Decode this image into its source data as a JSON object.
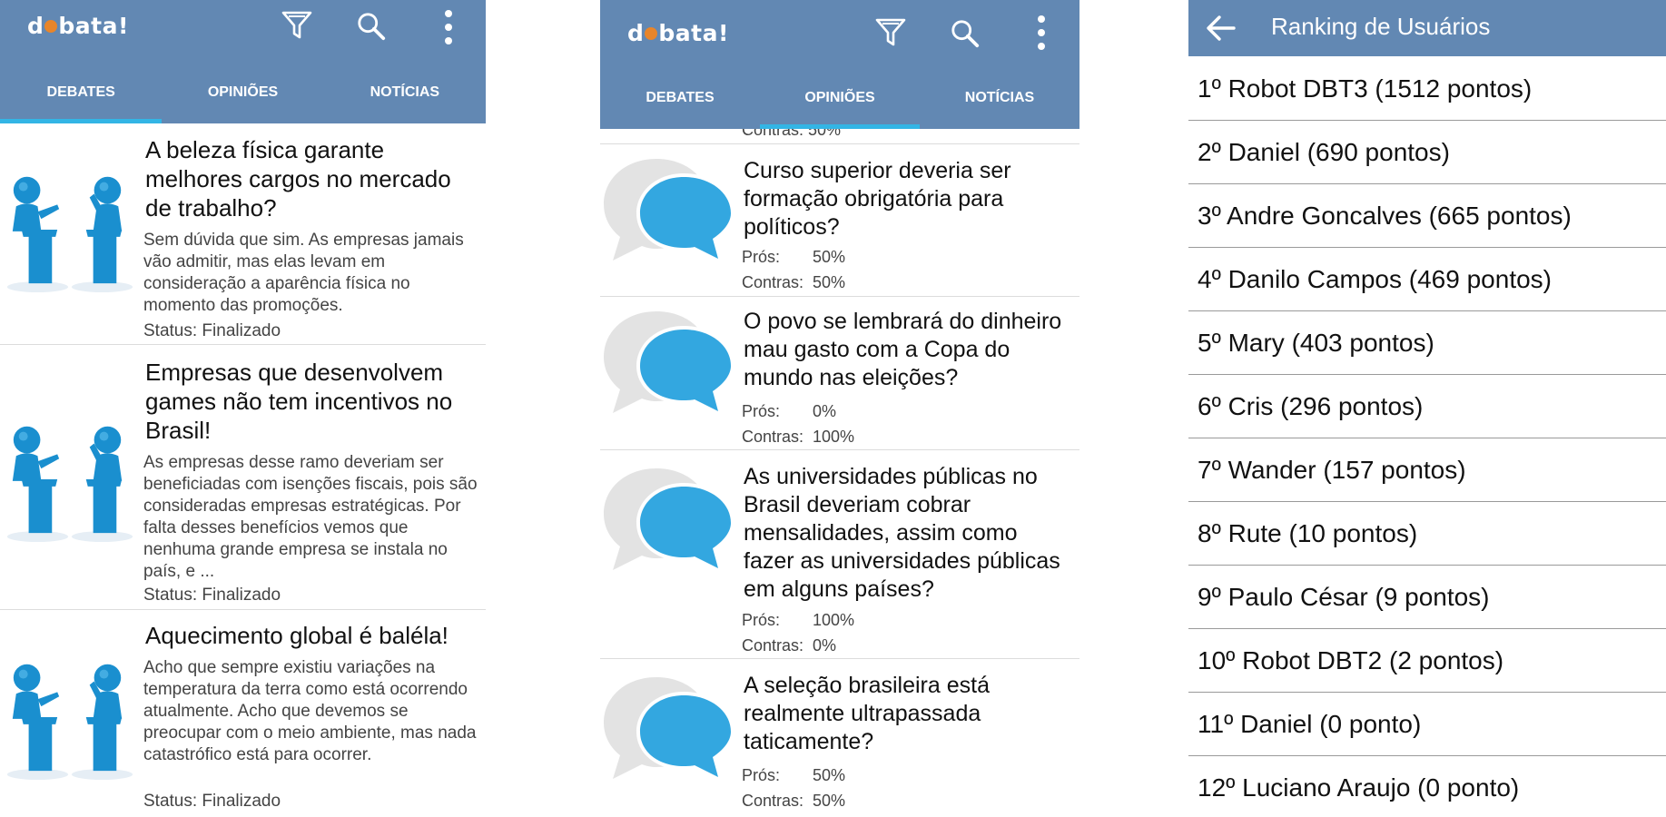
{
  "screen1": {
    "logo": {
      "before": "d",
      "after": "bata!"
    },
    "tabs": [
      "DEBATES",
      "OPINIÕES",
      "NOTÍCIAS"
    ],
    "debates": [
      {
        "title": "A beleza física garante melhores cargos no mercado de trabalho?",
        "summary": "Sem dúvida que sim.  As empresas jamais vão admitir, mas elas levam em consideração a aparência física no momento das promoções.",
        "status": "Status: Finalizado"
      },
      {
        "title": "Empresas que desenvolvem games não tem incentivos no Brasil!",
        "summary": "As empresas desse ramo deveriam ser beneficiadas com isenções fiscais, pois são consideradas empresas estratégicas. Por falta desses benefícios vemos que nenhuma grande empresa se instala no país, e ...",
        "status": "Status: Finalizado"
      },
      {
        "title": "Aquecimento global é baléla!",
        "summary": "Acho que sempre existiu variações na temperatura da terra como está ocorrendo atualmente. Acho que devemos se preocupar com o meio ambiente, mas nada catastrófico está para ocorrer.",
        "status": "Status: Finalizado"
      }
    ]
  },
  "screen2": {
    "logo": {
      "before": "d",
      "after": "bata!"
    },
    "tabs": [
      "DEBATES",
      "OPINIÕES",
      "NOTÍCIAS"
    ],
    "cut_text": "Contras: 50%",
    "opinions": [
      {
        "title": "Curso superior deveria ser formação obrigatória para políticos?",
        "pros_label": "Prós:",
        "pros": "50%",
        "cons_label": "Contras:",
        "cons": "50%"
      },
      {
        "title": "O povo se lembrará do dinheiro mau gasto com a Copa do mundo nas eleições?",
        "pros_label": "Prós:",
        "pros": "0%",
        "cons_label": "Contras:",
        "cons": "100%"
      },
      {
        "title": "As universidades públicas no Brasil deveriam cobrar mensalidades, assim como fazer as universidades públicas em alguns países?",
        "pros_label": "Prós:",
        "pros": "100%",
        "cons_label": "Contras:",
        "cons": "0%"
      },
      {
        "title": "A seleção brasileira está realmente ultrapassada taticamente?",
        "pros_label": "Prós:",
        "pros": "50%",
        "cons_label": "Contras:",
        "cons": "50%"
      }
    ]
  },
  "screen3": {
    "title": "Ranking de Usuários",
    "ranking": [
      "1º Robot DBT3 (1512 pontos)",
      "2º Daniel (690 pontos)",
      "3º Andre Goncalves (665 pontos)",
      "4º Danilo Campos (469 pontos)",
      "5º Mary (403 pontos)",
      "6º Cris (296 pontos)",
      "7º Wander (157 pontos)",
      "8º Rute (10 pontos)",
      "9º Paulo César (9 pontos)",
      "10º Robot DBT2 (2 pontos)",
      "11º Daniel (0 ponto)",
      "12º Luciano Araujo (0 ponto)"
    ]
  },
  "icons": {
    "filter": "filter-icon",
    "search": "search-icon",
    "overflow": "overflow-menu-icon",
    "back": "back-arrow-icon",
    "debate_thumb": "debate-podium-icon",
    "opinion_thumb": "speech-bubble-icon"
  },
  "colors": {
    "appbar": "#6288b3",
    "tab_indicator": "#33b5e5",
    "logo_dot": "#e8852a",
    "bubble": "#33a7e0"
  }
}
